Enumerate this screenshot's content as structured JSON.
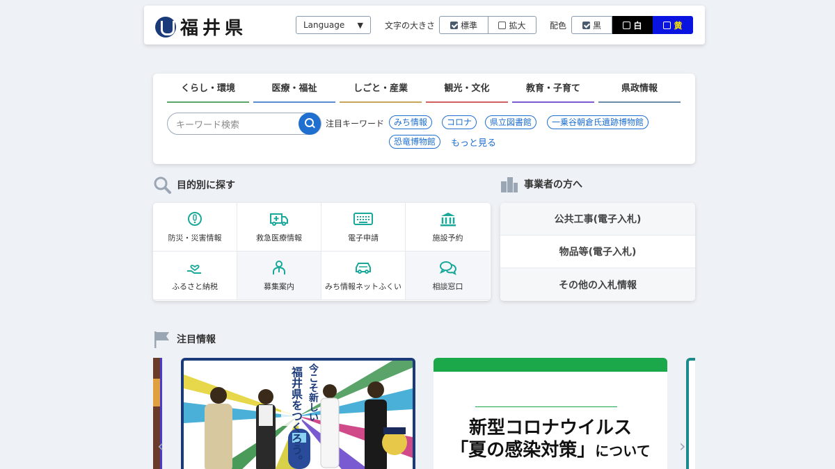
{
  "header": {
    "logo_text": "福井県",
    "language_label": "Language",
    "font_size_label": "文字の大きさ",
    "font_standard": "標準",
    "font_large": "拡大",
    "color_label": "配色",
    "color_black": "黒",
    "color_white": "白",
    "color_yellow": "黄"
  },
  "nav": {
    "tabs": [
      {
        "label": "くらし・環境",
        "color": "#5aa469"
      },
      {
        "label": "医療・福祉",
        "color": "#5a8ad0"
      },
      {
        "label": "しごと・産業",
        "color": "#c8a35a"
      },
      {
        "label": "観光・文化",
        "color": "#d06060"
      },
      {
        "label": "教育・子育て",
        "color": "#7a5ad0"
      },
      {
        "label": "県政情報",
        "color": "#6a8aa8"
      }
    ],
    "search_placeholder": "キーワード検索",
    "keywords_label": "注目キーワード",
    "keywords": [
      "みち情報",
      "コロナ",
      "県立図書館",
      "一乗谷朝倉氏遺跡博物館",
      "恐竜博物館"
    ],
    "more_label": "もっと見る"
  },
  "purpose": {
    "title": "目的別に探す",
    "items": [
      {
        "label": "防災・災害情報",
        "icon": "alert-icon"
      },
      {
        "label": "救急医療情報",
        "icon": "ambulance-icon"
      },
      {
        "label": "電子申請",
        "icon": "keyboard-icon"
      },
      {
        "label": "施設予約",
        "icon": "building-icon"
      },
      {
        "label": "ふるさと納税",
        "icon": "heart-hand-icon"
      },
      {
        "label": "募集案内",
        "icon": "person-icon"
      },
      {
        "label": "みち情報ネットふくい",
        "icon": "car-icon"
      },
      {
        "label": "相談窓口",
        "icon": "chat-icon"
      }
    ]
  },
  "business": {
    "title": "事業者の方へ",
    "items": [
      "公共工事(電子入札)",
      "物品等(電子入札)",
      "その他の入札情報"
    ]
  },
  "featured": {
    "title": "注目情報",
    "banner2_line1": "新型コロナウイルス",
    "banner2_line2a": "「夏の感染対策」",
    "banner2_line2b": "について",
    "banner1_text1": "今こそ新しい",
    "banner1_text2": "福井県をつくろう。"
  },
  "colors": {
    "accent": "#1e6fd0",
    "icon_teal": "#1aa89a"
  }
}
